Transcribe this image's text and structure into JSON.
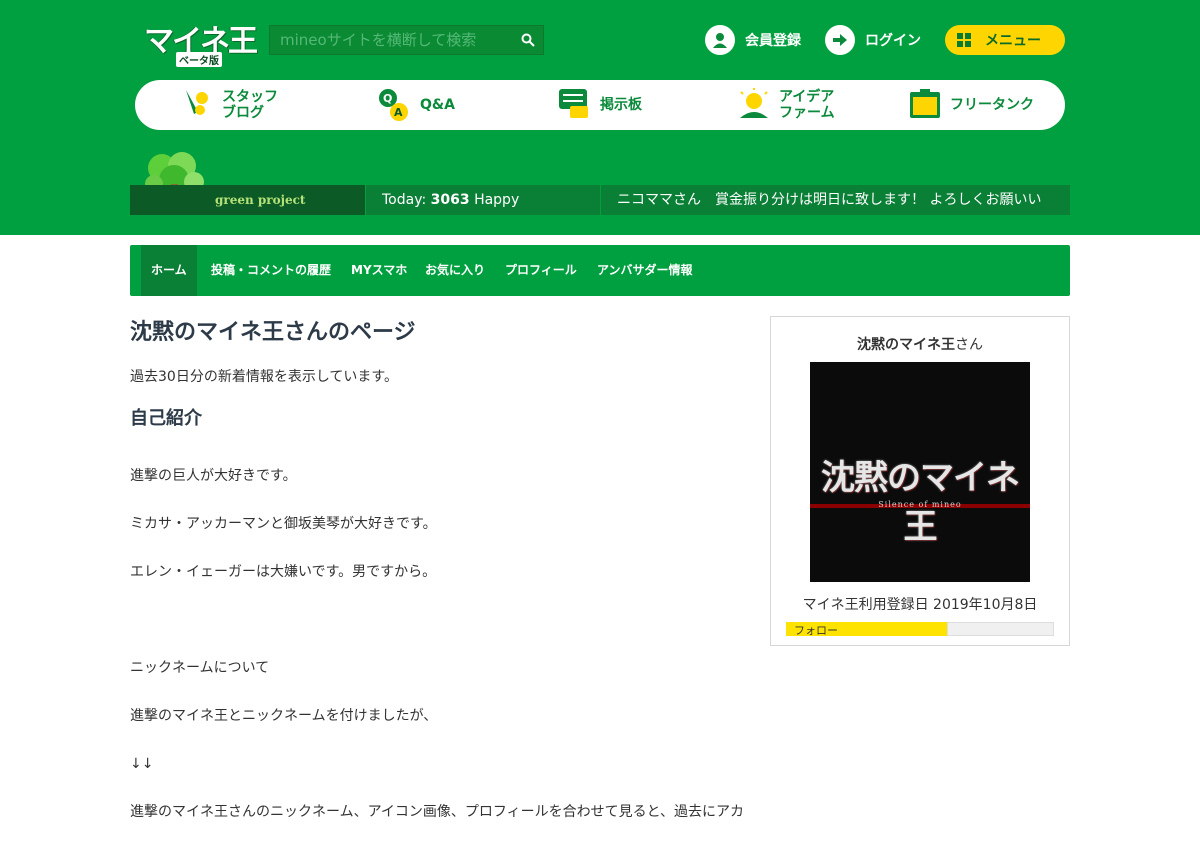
{
  "header": {
    "logo_text": "マイネ王",
    "logo_sub": "ベータ版",
    "search_placeholder": "mineoサイトを横断して検索",
    "register_label": "会員登録",
    "login_label": "ログイン",
    "menu_label": "メニュー"
  },
  "nav": [
    {
      "label": "スタッフ\nブログ",
      "icon": "pen-icon"
    },
    {
      "label": "Q&A",
      "icon": "qa-icon"
    },
    {
      "label": "掲示板",
      "icon": "chat-icon"
    },
    {
      "label": "アイデア\nファーム",
      "icon": "bulb-icon"
    },
    {
      "label": "フリータンク",
      "icon": "tank-icon"
    }
  ],
  "infobar": {
    "green_project": "green project",
    "today_prefix": "Today:",
    "today_count": "3063",
    "today_suffix": "Happy",
    "ticker": "ニコママさん　賞金振り分けは明日に致します！ よろしくお願いい"
  },
  "subnav": [
    "ホーム",
    "投稿・コメントの履歴",
    "MYスマホ",
    "お気に入り",
    "プロフィール",
    "アンバサダー情報"
  ],
  "main": {
    "title": "沈黙のマイネ王さんのページ",
    "lead": "過去30日分の新着情報を表示しています。",
    "section_title": "自己紹介",
    "bio_lines": [
      "進撃の巨人が大好きです。",
      "ミカサ・アッカーマンと御坂美琴が大好きです。",
      "エレン・イェーガーは大嫌いです。男ですから。",
      "",
      "ニックネームについて",
      "進撃のマイネ王とニックネームを付けましたが、",
      "↓↓",
      "進撃のマイネ王さんのニックネーム、アイコン画像、プロフィールを合わせて見ると、過去にアカ"
    ]
  },
  "sidebar": {
    "username": "沈黙のマイネ王",
    "username_suffix": "さん",
    "avatar_title": "沈黙のマイネ王",
    "avatar_subtitle": "Silence of mineo",
    "registered": "マイネ王利用登録日 2019年10月8日",
    "tab_label": "フォロー"
  },
  "colors": {
    "brand_green": "#00a040",
    "dark_green": "#0a7f36",
    "accent_yellow": "#ffd500"
  }
}
